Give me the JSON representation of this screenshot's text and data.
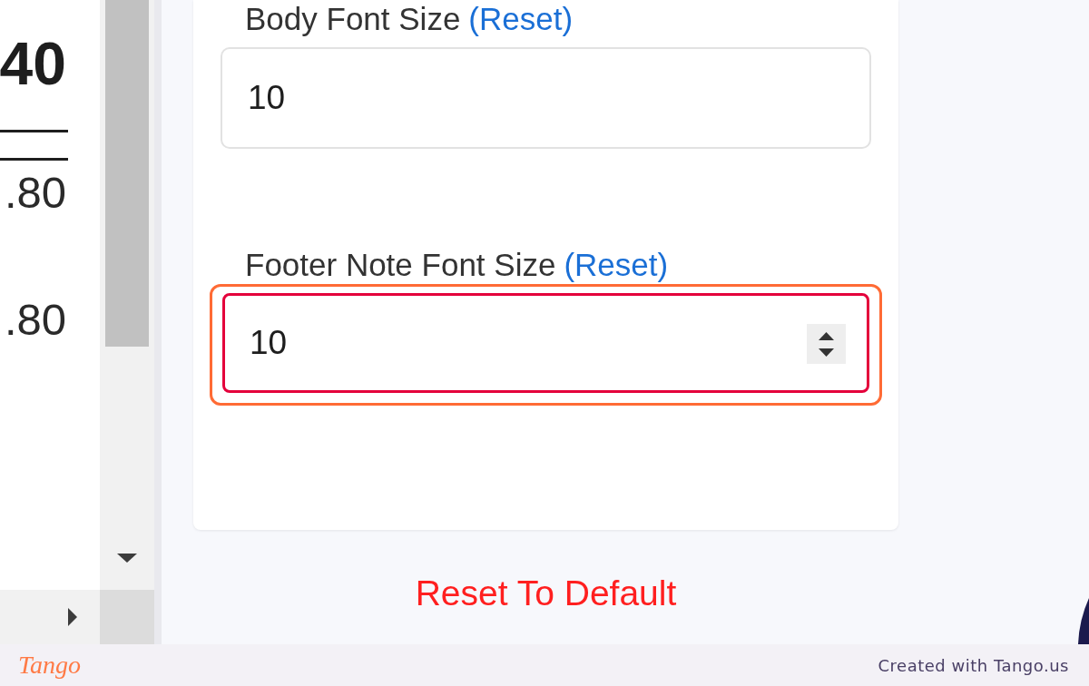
{
  "document_preview": {
    "values": [
      {
        "text": "40",
        "kind": "total"
      },
      {
        "text": ".80",
        "kind": "amount"
      },
      {
        "text": ".80",
        "kind": "amount"
      }
    ]
  },
  "settings_card": {
    "fields": [
      {
        "label": "Body Font Size",
        "reset_link": "(Reset)",
        "value": "10",
        "focused": false,
        "highlighted": false
      },
      {
        "label": "Footer Note Font Size",
        "reset_link": "(Reset)",
        "value": "10",
        "focused": true,
        "highlighted": true
      }
    ]
  },
  "reset_button": {
    "label": "Reset To Default"
  },
  "footer": {
    "logo": "Tango",
    "credit": "Created with Tango.us"
  }
}
